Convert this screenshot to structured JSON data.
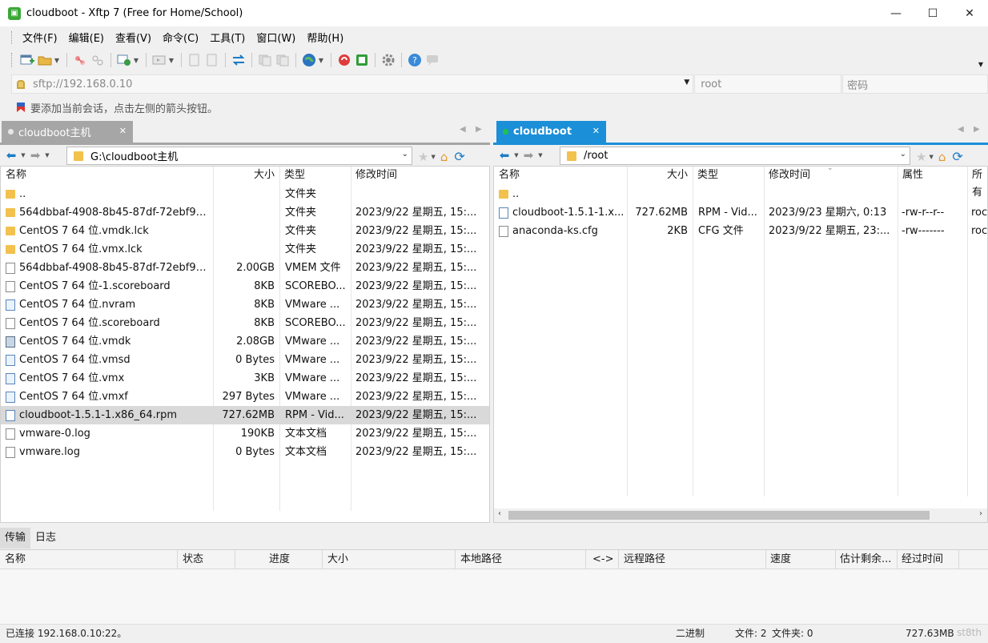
{
  "window": {
    "title": "cloudboot - Xftp 7 (Free for Home/School)",
    "icon": "xftp-app-icon"
  },
  "menu": [
    "文件(F)",
    "编辑(E)",
    "查看(V)",
    "命令(C)",
    "工具(T)",
    "窗口(W)",
    "帮助(H)"
  ],
  "address": {
    "host": "sftp://192.168.0.10",
    "user_placeholder": "root",
    "password_placeholder": "密码"
  },
  "hint": "要添加当前会话，点击左侧的箭头按钮。",
  "left_pane": {
    "tab": {
      "label": "cloudboot主机",
      "status_color": "#e6e6e6"
    },
    "path": "G:\\cloudboot主机",
    "columns": [
      "名称",
      "大小",
      "类型",
      "修改时间"
    ],
    "rows": [
      {
        "icon": "folder",
        "name": "..",
        "size": "",
        "type": "文件夹",
        "mtime": ""
      },
      {
        "icon": "folder",
        "name": "564dbbaf-4908-8b45-87df-72ebf97...",
        "size": "",
        "type": "文件夹",
        "mtime": "2023/9/22 星期五, 15:..."
      },
      {
        "icon": "folder",
        "name": "CentOS 7 64 位.vmdk.lck",
        "size": "",
        "type": "文件夹",
        "mtime": "2023/9/22 星期五, 15:..."
      },
      {
        "icon": "folder",
        "name": "CentOS 7 64 位.vmx.lck",
        "size": "",
        "type": "文件夹",
        "mtime": "2023/9/22 星期五, 15:..."
      },
      {
        "icon": "file",
        "name": "564dbbaf-4908-8b45-87df-72ebf97...",
        "size": "2.00GB",
        "type": "VMEM 文件",
        "mtime": "2023/9/22 星期五, 15:..."
      },
      {
        "icon": "file",
        "name": "CentOS 7 64 位-1.scoreboard",
        "size": "8KB",
        "type": "SCOREBO...",
        "mtime": "2023/9/22 星期五, 15:..."
      },
      {
        "icon": "vm",
        "name": "CentOS 7 64 位.nvram",
        "size": "8KB",
        "type": "VMware ...",
        "mtime": "2023/9/22 星期五, 15:..."
      },
      {
        "icon": "file",
        "name": "CentOS 7 64 位.scoreboard",
        "size": "8KB",
        "type": "SCOREBO...",
        "mtime": "2023/9/22 星期五, 15:..."
      },
      {
        "icon": "disk",
        "name": "CentOS 7 64 位.vmdk",
        "size": "2.08GB",
        "type": "VMware ...",
        "mtime": "2023/9/22 星期五, 15:..."
      },
      {
        "icon": "vm",
        "name": "CentOS 7 64 位.vmsd",
        "size": "0 Bytes",
        "type": "VMware ...",
        "mtime": "2023/9/22 星期五, 15:..."
      },
      {
        "icon": "vm",
        "name": "CentOS 7 64 位.vmx",
        "size": "3KB",
        "type": "VMware ...",
        "mtime": "2023/9/22 星期五, 15:..."
      },
      {
        "icon": "vm",
        "name": "CentOS 7 64 位.vmxf",
        "size": "297 Bytes",
        "type": "VMware ...",
        "mtime": "2023/9/22 星期五, 15:..."
      },
      {
        "icon": "rpm",
        "name": "cloudboot-1.5.1-1.x86_64.rpm",
        "size": "727.62MB",
        "type": "RPM - Vid...",
        "mtime": "2023/9/22 星期五, 15:...",
        "selected": true
      },
      {
        "icon": "file",
        "name": "vmware-0.log",
        "size": "190KB",
        "type": "文本文档",
        "mtime": "2023/9/22 星期五, 15:..."
      },
      {
        "icon": "file",
        "name": "vmware.log",
        "size": "0 Bytes",
        "type": "文本文档",
        "mtime": "2023/9/22 星期五, 15:..."
      }
    ]
  },
  "right_pane": {
    "tab": {
      "label": "cloudboot",
      "status_color": "#22c24a"
    },
    "path": "/root",
    "columns": [
      "名称",
      "大小",
      "类型",
      "修改时间",
      "属性",
      "所有"
    ],
    "rows": [
      {
        "icon": "folder",
        "name": "..",
        "size": "",
        "type": "",
        "mtime": "",
        "attr": "",
        "owner": ""
      },
      {
        "icon": "rpm",
        "name": "cloudboot-1.5.1-1.x...",
        "size": "727.62MB",
        "type": "RPM - Vid...",
        "mtime": "2023/9/23 星期六, 0:13",
        "attr": "-rw-r--r--",
        "owner": "roc"
      },
      {
        "icon": "file",
        "name": "anaconda-ks.cfg",
        "size": "2KB",
        "type": "CFG 文件",
        "mtime": "2023/9/22 星期五, 23:...",
        "attr": "-rw-------",
        "owner": "roc"
      }
    ]
  },
  "bottom": {
    "tabs": [
      "传输",
      "日志"
    ],
    "columns": [
      "名称",
      "状态",
      "进度",
      "大小",
      "本地路径",
      "<->",
      "远程路径",
      "速度",
      "估计剩余...",
      "经过时间"
    ]
  },
  "status": {
    "connection": "已连接 192.168.0.10:22。",
    "mode": "二进制",
    "files": "文件: 2",
    "folders": "文件夹: 0",
    "size": "727.63MB",
    "watermark": "st8th"
  },
  "colors": {
    "accent": "#1b8fd8",
    "selected_row": "#d9d9d9"
  }
}
